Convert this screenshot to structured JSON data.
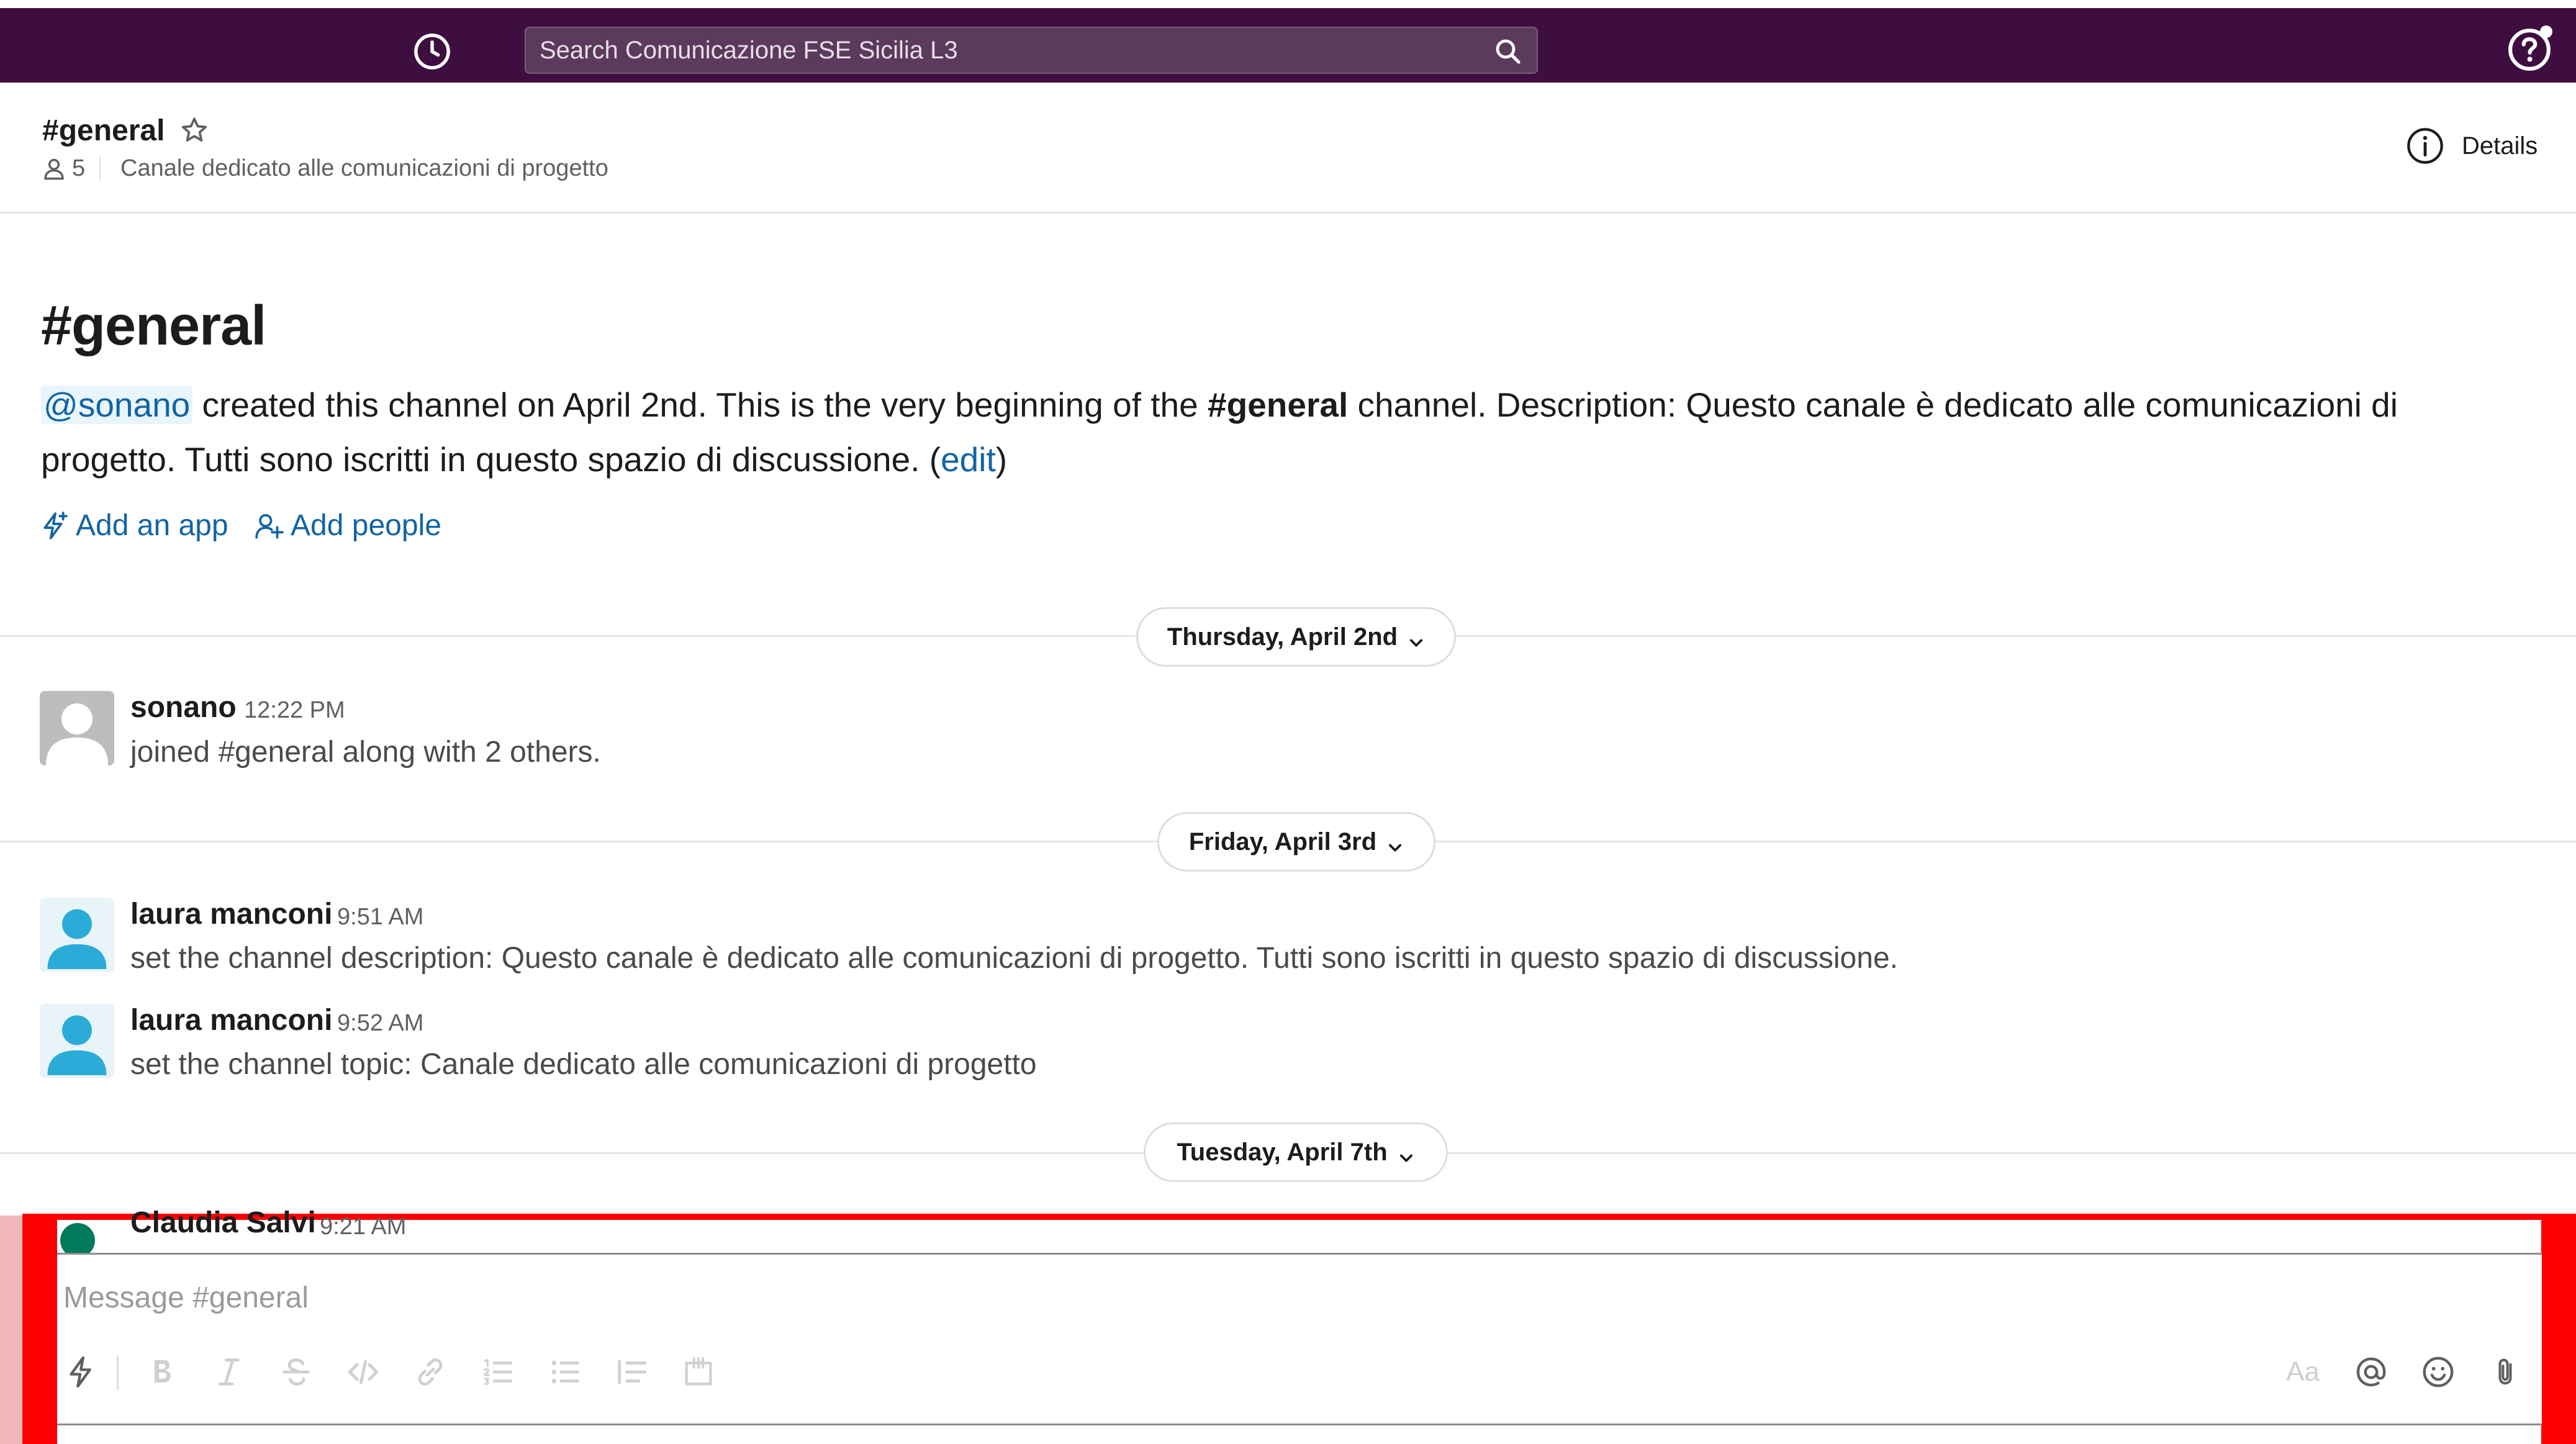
{
  "top_bar": {
    "search_placeholder": "Search Comunicazione FSE Sicilia L3"
  },
  "channel_header": {
    "name": "#general",
    "member_count": "5",
    "topic": "Canale dedicato alle comunicazioni di progetto",
    "details_label": "Details"
  },
  "intro": {
    "title": "#general",
    "mention": "@sonano",
    "text_1": " created this channel on April 2nd. This is the very beginning of the ",
    "channel_bold": "#general",
    "text_2": " channel. Description: Questo canale è dedicato alle comunicazioni di progetto. Tutti sono iscritti in questo spazio di discussione. (",
    "edit_label": "edit",
    "text_3": ")",
    "add_app_label": "Add an app",
    "add_people_label": "Add people"
  },
  "days": [
    {
      "label": "Thursday, April 2nd"
    },
    {
      "label": "Friday, April 3rd"
    },
    {
      "label": "Tuesday, April 7th"
    }
  ],
  "messages": [
    {
      "author": "sonano",
      "time": "12:22 PM",
      "text": "joined #general along with 2 others."
    },
    {
      "author": "laura manconi",
      "time": "9:51 AM",
      "text": "set the channel description: Questo canale è dedicato alle comunicazioni di progetto. Tutti sono iscritti in questo spazio di discussione."
    },
    {
      "author": "laura manconi",
      "time": "9:52 AM",
      "text": "set the channel topic: Canale dedicato alle comunicazioni di progetto"
    },
    {
      "author": "Claudia Salvi",
      "time": "9:21 AM",
      "text": ""
    }
  ],
  "composer": {
    "placeholder": "Message #general",
    "toolbar_left": [
      "shortcuts-icon",
      "bold-icon",
      "italic-icon",
      "strikethrough-icon",
      "code-icon",
      "link-icon",
      "ordered-list-icon",
      "bulleted-list-icon",
      "blockquote-icon",
      "code-block-icon"
    ],
    "toolbar_right": [
      "formatting-icon",
      "mention-icon",
      "emoji-icon",
      "attachment-icon"
    ],
    "formatting_label": "Aa"
  },
  "colors": {
    "top_bar": "#3f0e40",
    "link": "#1264a3",
    "highlight_frame": "#ff0000",
    "avatar_blue": "#2bacd8",
    "avatar_gray": "#bdbdbd",
    "avatar_green": "#007a5a"
  }
}
